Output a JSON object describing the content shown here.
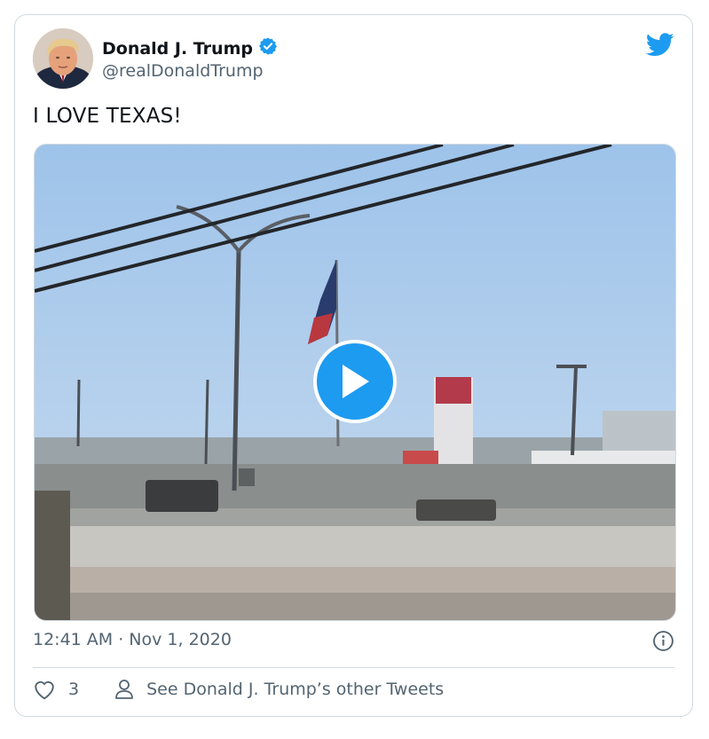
{
  "tweet": {
    "author_name": "Donald J. Trump",
    "author_handle": "@realDonaldTrump",
    "verified": true,
    "text": "I LOVE TEXAS!",
    "timestamp": "12:41 AM · Nov 1, 2020",
    "like_count": "3",
    "other_tweets_label": "See Donald J. Trump’s other Tweets"
  },
  "icons": {
    "brand": "twitter-bird-icon",
    "verified": "verified-badge-icon",
    "play": "play-icon",
    "info": "info-icon",
    "like": "heart-icon",
    "profile": "person-icon"
  },
  "colors": {
    "accent": "#1d9bf0",
    "text": "#0f1419",
    "secondary_text": "#536471",
    "border": "#cfd9de"
  }
}
